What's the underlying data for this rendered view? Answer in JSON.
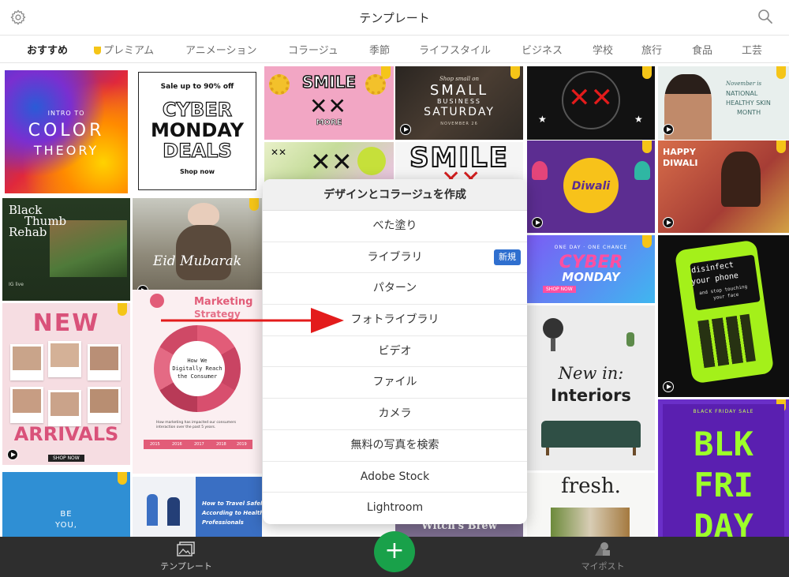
{
  "header": {
    "title": "テンプレート"
  },
  "tabs": [
    {
      "label": "おすすめ"
    },
    {
      "label": "プレミアム"
    },
    {
      "label": "アニメーション"
    },
    {
      "label": "コラージュ"
    },
    {
      "label": "季節"
    },
    {
      "label": "ライフスタイル"
    },
    {
      "label": "ビジネス"
    },
    {
      "label": "学校"
    },
    {
      "label": "旅行"
    },
    {
      "label": "食品"
    },
    {
      "label": "工芸"
    }
  ],
  "tiles": {
    "color_theory": {
      "line1": "INTRO TO",
      "line2": "COLOR",
      "line3": "THEORY"
    },
    "cyber_monday": {
      "top": "Sale up to 90% off",
      "l1": "CYBER",
      "l2": "MONDAY",
      "l3": "DEALS",
      "cta": "Shop now"
    },
    "smile_1": {
      "title": "SMILE",
      "sub": "MORE"
    },
    "small_business": {
      "top": "Shop small on",
      "l1": "SMALL",
      "l2": "BUSINESS",
      "l3": "SATURDAY",
      "date": "NOVEMBER 26"
    },
    "skin_health": {
      "l1": "November is",
      "l2": "NATIONAL",
      "l3": "HEALTHY SKIN",
      "l4": "MONTH"
    },
    "smile_2": {
      "title": "SMILE"
    },
    "happy_diwali_1": {
      "text": "Diwali"
    },
    "happy_diwali_2": {
      "l1": "HAPPY",
      "l2": "DIWALI"
    },
    "black_thumb": {
      "l1": "Black",
      "l2": "Thumb",
      "l3": "Rehab",
      "foot": "IG live"
    },
    "eid": {
      "l1": "Eid Mubarak"
    },
    "cyber_monday_2": {
      "top": "ONE DAY · ONE CHANCE",
      "l1": "CYBER",
      "l2": "MONDAY",
      "cta": "SHOP NOW"
    },
    "disinfect": {
      "l1": "disinfect",
      "l2": "your phone",
      "l3": "and stop touching",
      "l4": "your face"
    },
    "new_arrivals": {
      "l1": "NEW",
      "l2": "ARRIVALS",
      "cta": "SHOP NOW"
    },
    "marketing": {
      "l1": "Marketing",
      "l2": "Strategy",
      "center1": "How We",
      "center2": "Digitally Reach",
      "center3": "the Consumer",
      "foot": "How marketing has impacted our consumers interaction over the past 5 years.",
      "years": [
        "2015",
        "2016",
        "2017",
        "2018",
        "2019"
      ]
    },
    "interiors": {
      "l1": "New in:",
      "l2": "Interiors"
    },
    "fresh": {
      "l1": "fresh."
    },
    "blk_friday": {
      "top": "BLACK FRIDAY SALE",
      "l1": "BLK",
      "l2": "FRI",
      "l3": "DAY"
    },
    "be_you": {
      "l1": "BE",
      "l2": "YOU,"
    },
    "travel": {
      "l1": "How to Travel Safely",
      "l2": "According to Health",
      "l3": "Professionals"
    },
    "witch": {
      "l1": "Witch's Brew"
    }
  },
  "popup": {
    "title": "デザインとコラージュを作成",
    "items": [
      {
        "label": "べた塗り"
      },
      {
        "label": "ライブラリ",
        "badge": "新規"
      },
      {
        "label": "パターン"
      },
      {
        "label": "フォトライブラリ"
      },
      {
        "label": "ビデオ"
      },
      {
        "label": "ファイル"
      },
      {
        "label": "カメラ"
      },
      {
        "label": "無料の写真を検索"
      },
      {
        "label": "Adobe Stock"
      },
      {
        "label": "Lightroom"
      }
    ]
  },
  "bottom": {
    "templates_label": "テンプレート",
    "myposts_label": "マイポスト",
    "fab_icon": "+"
  },
  "colors": {
    "accent_green": "#19a14a",
    "premium_gold": "#f5c518",
    "new_badge_blue": "#2f6fcf",
    "arrow_red": "#e31b1b",
    "bottom_bar": "#2e2e2e"
  }
}
